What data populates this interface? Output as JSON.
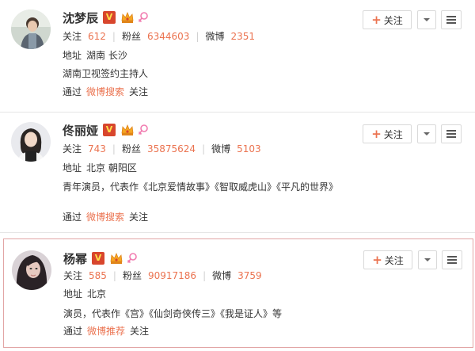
{
  "users": [
    {
      "name": "沈梦辰",
      "verified_badge": "V",
      "stats": {
        "following_label": "关注",
        "following": "612",
        "fans_label": "粉丝",
        "fans": "6344603",
        "weibo_label": "微博",
        "weibo": "2351"
      },
      "address_label": "地址",
      "address": "湖南 长沙",
      "description": "湖南卫视签约主持人",
      "via_prefix": "通过",
      "via_link": "微博搜索",
      "via_suffix": "关注",
      "follow_label": "关注"
    },
    {
      "name": "佟丽娅",
      "verified_badge": "V",
      "stats": {
        "following_label": "关注",
        "following": "743",
        "fans_label": "粉丝",
        "fans": "35875624",
        "weibo_label": "微博",
        "weibo": "5103"
      },
      "address_label": "地址",
      "address": "北京 朝阳区",
      "description": "青年演员，代表作《北京爱情故事》《智取威虎山》《平凡的世界》",
      "via_prefix": "通过",
      "via_link": "微博搜索",
      "via_suffix": "关注",
      "follow_label": "关注"
    },
    {
      "name": "杨幂",
      "verified_badge": "V",
      "stats": {
        "following_label": "关注",
        "following": "585",
        "fans_label": "粉丝",
        "fans": "90917186",
        "weibo_label": "微博",
        "weibo": "3759"
      },
      "address_label": "地址",
      "address": "北京",
      "description": "演员，代表作《宫》《仙剑奇侠传三》《我是证人》等",
      "via_prefix": "通过",
      "via_link": "微博推荐",
      "via_suffix": "关注",
      "follow_label": "关注"
    }
  ],
  "colors": {
    "accent": "#eb7350",
    "vbadge": "#d8462d",
    "highlight_border": "#e2a5a5"
  },
  "icons": {
    "verified": "verified-v-icon",
    "crown": "crown-icon",
    "gender": "female-icon",
    "dropdown": "chevron-down-icon",
    "menu": "menu-icon"
  }
}
